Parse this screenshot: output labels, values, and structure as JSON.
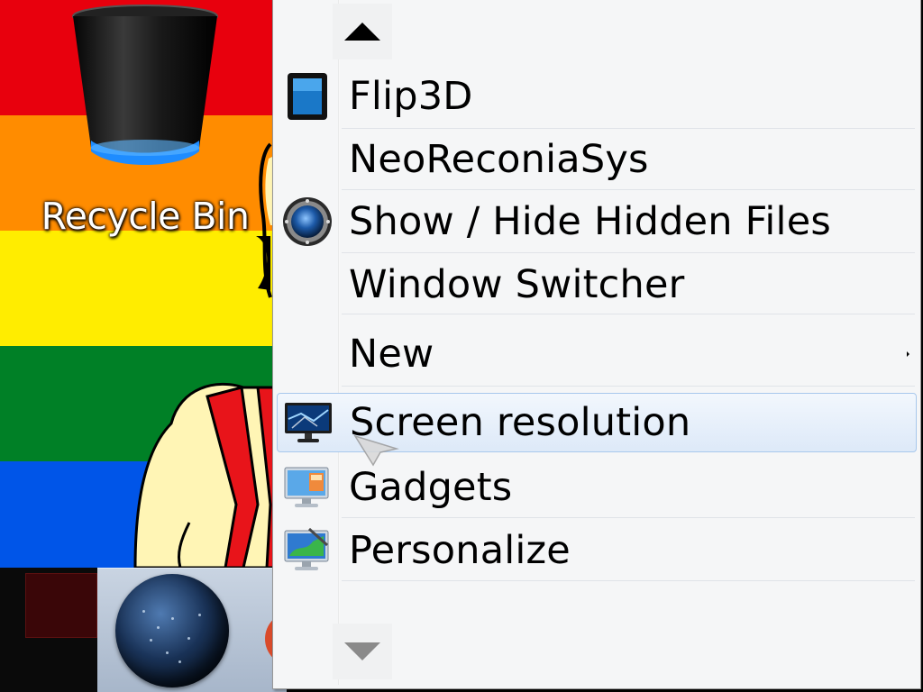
{
  "desktop": {
    "recycle_bin": {
      "label": "Recycle Bin",
      "icon": "recycle-bin-icon"
    },
    "colors": {
      "red": "#e8000d",
      "orange": "#ff8c00",
      "yellow": "#ffed00",
      "green": "#008026",
      "blue": "#0055e8"
    }
  },
  "context_menu": {
    "items": [
      {
        "label": "Flip3D",
        "icon": "flip3d-icon"
      },
      {
        "label": "NeoReconiaSys",
        "icon": ""
      },
      {
        "label": "Show / Hide Hidden Files",
        "icon": "hidden-files-orb-icon"
      },
      {
        "label": "Window Switcher",
        "icon": ""
      },
      {
        "label": "New",
        "icon": "",
        "has_submenu": true
      },
      {
        "label": "Screen resolution",
        "icon": "monitor-icon",
        "highlighted": true
      },
      {
        "label": "Gadgets",
        "icon": "gadgets-icon"
      },
      {
        "label": "Personalize",
        "icon": "personalize-icon"
      }
    ],
    "scroll_up_icon": "scroll-up-arrow-icon",
    "scroll_down_icon": "scroll-down-arrow-icon",
    "hover_color": "#dde9f8"
  },
  "taskbar": {
    "pinned_icon": "globe-icon"
  }
}
